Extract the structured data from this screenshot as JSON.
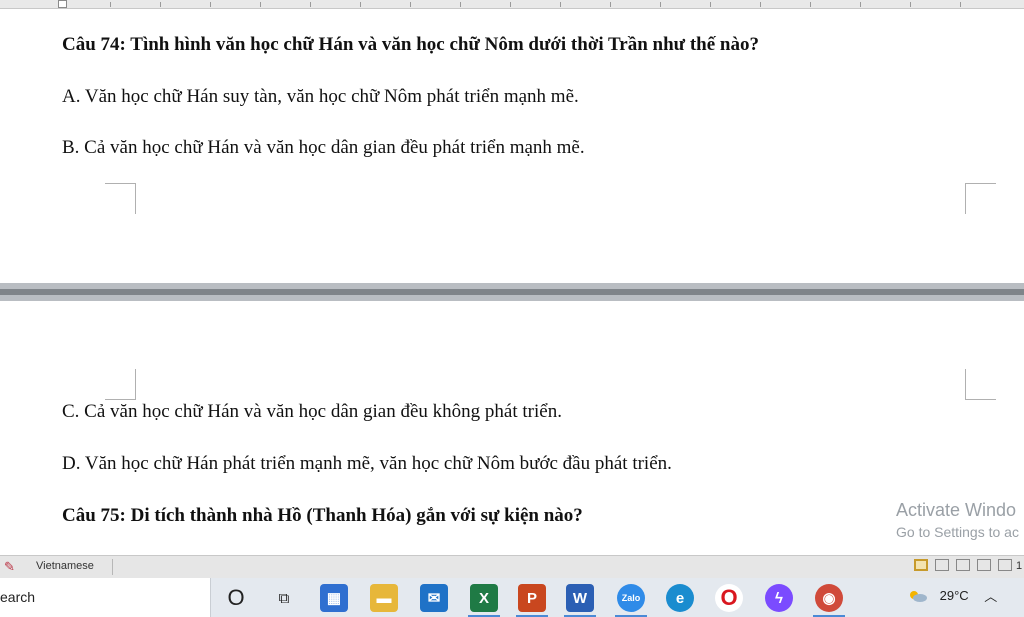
{
  "document": {
    "lines_page1": [
      "Câu 74: Tình hình văn học chữ Hán và văn học chữ Nôm dưới thời Trần như thế nào?",
      "A. Văn học chữ Hán suy tàn, văn học chữ Nôm phát triển mạnh mẽ.",
      "B. Cả văn học chữ Hán và văn học dân gian đều phát triển mạnh mẽ."
    ],
    "lines_page2": [
      "C. Cả văn học chữ Hán và văn học dân gian đều không phát triển.",
      "D. Văn học chữ Hán phát triển mạnh mẽ, văn học chữ Nôm bước đầu phát triển.",
      "Câu 75: Di tích thành nhà Hồ (Thanh Hóa) gắn với sự kiện nào?"
    ]
  },
  "watermark": {
    "line1": "Activate Windo",
    "line2": "Go to Settings to ac"
  },
  "statusbar": {
    "language": "Vietnamese",
    "zoom_partial": "1"
  },
  "taskbar": {
    "search_text": "earch",
    "apps": [
      {
        "name": "cortana-icon",
        "glyph": "O"
      },
      {
        "name": "task-view-icon",
        "glyph": "⧉"
      },
      {
        "name": "store-icon",
        "glyph": "▦"
      },
      {
        "name": "file-explorer-icon",
        "glyph": "▬"
      },
      {
        "name": "mail-icon",
        "glyph": "✉"
      },
      {
        "name": "excel-icon",
        "glyph": "X"
      },
      {
        "name": "powerpoint-icon",
        "glyph": "P"
      },
      {
        "name": "word-icon",
        "glyph": "W"
      },
      {
        "name": "zalo-icon",
        "glyph": "Zalo"
      },
      {
        "name": "edge-icon",
        "glyph": "e"
      },
      {
        "name": "opera-icon",
        "glyph": "O"
      },
      {
        "name": "messenger-icon",
        "glyph": "ϟ"
      },
      {
        "name": "chrome-profile-icon",
        "glyph": "◉"
      }
    ],
    "temperature": "29°C"
  },
  "colors": {
    "excel": "#1f7a45",
    "powerpoint": "#c9471f",
    "word": "#2b5fb4",
    "edge": "#1a8ccf",
    "opera": "#d9171f",
    "messenger": "#7b4bff",
    "store": "#2f6fd0",
    "explorer": "#e7b73a",
    "mail": "#1f72c7",
    "zalo": "#2f8be8",
    "accent_underline": "#4a8ad6"
  }
}
